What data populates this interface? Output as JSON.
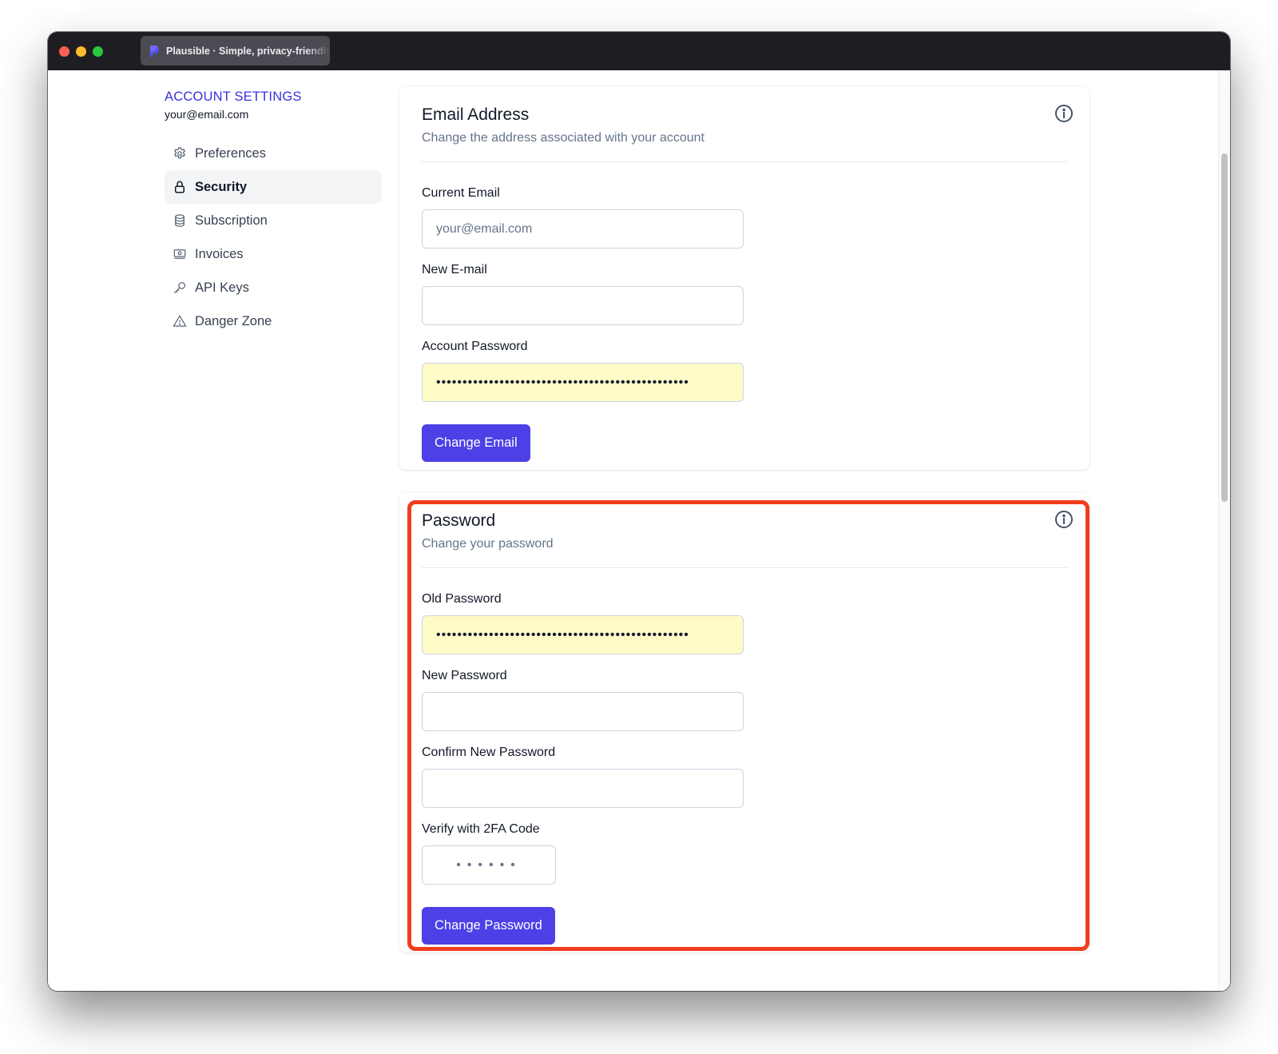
{
  "browser": {
    "tab_title": "Plausible · Simple, privacy-friendly"
  },
  "sidebar": {
    "heading": "ACCOUNT SETTINGS",
    "email": "your@email.com",
    "items": [
      {
        "label": "Preferences",
        "icon": "gear-icon",
        "active": false
      },
      {
        "label": "Security",
        "icon": "lock-icon",
        "active": true
      },
      {
        "label": "Subscription",
        "icon": "database-icon",
        "active": false
      },
      {
        "label": "Invoices",
        "icon": "banknotes-icon",
        "active": false
      },
      {
        "label": "API Keys",
        "icon": "key-icon",
        "active": false
      },
      {
        "label": "Danger Zone",
        "icon": "warning-icon",
        "active": false
      }
    ]
  },
  "email_card": {
    "title": "Email Address",
    "subtitle": "Change the address associated with your account",
    "current_email_label": "Current Email",
    "current_email_placeholder": "your@email.com",
    "new_email_label": "New E-mail",
    "new_email_value": "",
    "account_password_label": "Account Password",
    "account_password_value": "••••••••••••••••••••••••••••••••••••••••••••••••",
    "submit_label": "Change Email"
  },
  "password_card": {
    "title": "Password",
    "subtitle": "Change your password",
    "old_password_label": "Old Password",
    "old_password_value": "••••••••••••••••••••••••••••••••••••••••••••••••",
    "new_password_label": "New Password",
    "new_password_value": "",
    "confirm_password_label": "Confirm New Password",
    "confirm_password_value": "",
    "twofa_label": "Verify with 2FA Code",
    "twofa_placeholder": "••••••",
    "submit_label": "Change Password"
  },
  "colors": {
    "accent": "#4c40e6",
    "heading_accent": "#3b30e0",
    "highlight_border": "#f03d1f",
    "autofill_bg": "#fefbc7"
  }
}
